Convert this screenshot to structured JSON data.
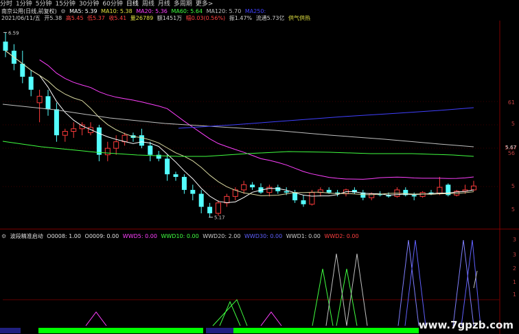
{
  "toolbar": {
    "items": [
      "分时",
      "1分钟",
      "5分钟",
      "15分钟",
      "30分钟",
      "60分钟",
      "日线",
      "周线",
      "月线",
      "多周期",
      "更多>"
    ],
    "active_index": 6
  },
  "header": {
    "stock": "南京公用(日线,前复权)",
    "ma5": "MA5: 5.39",
    "ma10": "MA10: 5.38",
    "ma20": "MA20: 5.36",
    "ma60": "MA60: 5.64",
    "ma120": "MA120: 5.70",
    "ma250": "MA250:"
  },
  "info": {
    "date": "2021/06/11/五",
    "open": "开5.38",
    "high": "高5.45",
    "low": "低5.37",
    "close": "收5.41",
    "volume": "量26789",
    "amount": "额1451万",
    "change": "幅0.03(0.56%)",
    "amplitude": "振1.47%",
    "turnover": "流通5.73亿",
    "sector": "供气供热"
  },
  "price_labels": {
    "high_mark": "6.59",
    "low_mark": "5.17",
    "current_mark": "5.67"
  },
  "right_scale": {
    "top": [
      "6",
      "61"
    ],
    "mid": [
      "5"
    ],
    "lower": [
      "5.67",
      "56"
    ],
    "bottom": [
      "5",
      "5"
    ],
    "ind": [
      "3",
      "3",
      "2",
      "1",
      "1"
    ]
  },
  "indicator": {
    "title": "波段精准启动",
    "v1": "O0008: 1.00",
    "v2": "O0009: 0.00",
    "wwd5": "WWD5: 0.00",
    "wwd10": "WWD10: 0.00",
    "wwd20": "WWD20: 2.00",
    "wwd30": "WWD30: 0.00",
    "wwd1": "WWD1: 0.00",
    "wwd2": "WWD2: 0.00"
  },
  "watermark": "www.7gpzb.com",
  "colors": {
    "up": "#ff3b3b",
    "down": "#54ffff",
    "ma5": "#ffffff",
    "ma10": "#e0e040",
    "ma20": "#ff40ff",
    "ma60": "#40ff40",
    "ma120": "#c0c0c0",
    "ma250": "#4040ff",
    "bar": "#00ff00"
  },
  "chart_data": {
    "type": "candlestick",
    "candles": [
      [
        6.52,
        6.59,
        6.4,
        6.45
      ],
      [
        6.45,
        6.5,
        6.3,
        6.35
      ],
      [
        6.35,
        6.45,
        6.2,
        6.25
      ],
      [
        6.25,
        6.3,
        6.1,
        6.15
      ],
      [
        6.05,
        6.15,
        5.9,
        6.1
      ],
      [
        6.1,
        6.15,
        5.95,
        6.0
      ],
      [
        6.0,
        6.05,
        5.75,
        5.8
      ],
      [
        5.8,
        5.85,
        5.75,
        5.83
      ],
      [
        5.83,
        5.9,
        5.78,
        5.85
      ],
      [
        5.85,
        5.9,
        5.8,
        5.88
      ],
      [
        5.82,
        5.9,
        5.8,
        5.86
      ],
      [
        5.86,
        5.88,
        5.6,
        5.65
      ],
      [
        5.65,
        5.75,
        5.6,
        5.7
      ],
      [
        5.7,
        5.8,
        5.65,
        5.75
      ],
      [
        5.75,
        5.82,
        5.72,
        5.8
      ],
      [
        5.8,
        5.82,
        5.75,
        5.78
      ],
      [
        5.8,
        5.85,
        5.7,
        5.72
      ],
      [
        5.72,
        5.75,
        5.6,
        5.65
      ],
      [
        5.65,
        5.68,
        5.6,
        5.62
      ],
      [
        5.62,
        5.65,
        5.45,
        5.5
      ],
      [
        5.5,
        5.52,
        5.45,
        5.48
      ],
      [
        5.48,
        5.5,
        5.35,
        5.38
      ],
      [
        5.38,
        5.42,
        5.3,
        5.35
      ],
      [
        5.35,
        5.38,
        5.2,
        5.25
      ],
      [
        5.25,
        5.28,
        5.17,
        5.2
      ],
      [
        5.2,
        5.3,
        5.18,
        5.28
      ],
      [
        5.28,
        5.35,
        5.25,
        5.33
      ],
      [
        5.33,
        5.4,
        5.3,
        5.38
      ],
      [
        5.38,
        5.45,
        5.35,
        5.42
      ],
      [
        5.42,
        5.44,
        5.38,
        5.4
      ],
      [
        5.4,
        5.43,
        5.35,
        5.36
      ],
      [
        5.36,
        5.42,
        5.33,
        5.4
      ],
      [
        5.4,
        5.42,
        5.35,
        5.37
      ],
      [
        5.37,
        5.4,
        5.34,
        5.36
      ],
      [
        5.36,
        5.38,
        5.28,
        5.3
      ],
      [
        5.3,
        5.34,
        5.25,
        5.27
      ],
      [
        5.27,
        5.38,
        5.26,
        5.36
      ],
      [
        5.36,
        5.4,
        5.33,
        5.38
      ],
      [
        5.38,
        5.4,
        5.35,
        5.36
      ],
      [
        5.36,
        5.38,
        5.33,
        5.35
      ],
      [
        5.35,
        5.39,
        5.33,
        5.38
      ],
      [
        5.38,
        5.4,
        5.35,
        5.36
      ],
      [
        5.36,
        5.38,
        5.3,
        5.32
      ],
      [
        5.32,
        5.36,
        5.3,
        5.35
      ],
      [
        5.35,
        5.37,
        5.33,
        5.34
      ],
      [
        5.34,
        5.36,
        5.32,
        5.33
      ],
      [
        5.33,
        5.4,
        5.32,
        5.38
      ],
      [
        5.38,
        5.4,
        5.33,
        5.34
      ],
      [
        5.34,
        5.36,
        5.3,
        5.33
      ],
      [
        5.33,
        5.37,
        5.32,
        5.36
      ],
      [
        5.36,
        5.38,
        5.34,
        5.35
      ],
      [
        5.35,
        5.48,
        5.34,
        5.4
      ],
      [
        5.42,
        5.43,
        5.33,
        5.34
      ],
      [
        5.34,
        5.38,
        5.33,
        5.37
      ],
      [
        5.37,
        5.42,
        5.35,
        5.38
      ],
      [
        5.38,
        5.45,
        5.37,
        5.41
      ]
    ]
  }
}
